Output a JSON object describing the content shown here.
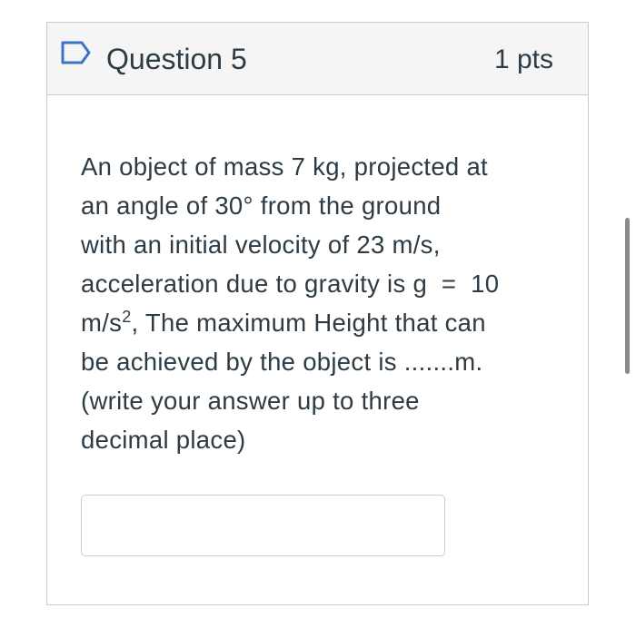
{
  "question": {
    "title": "Question 5",
    "points": "1 pts",
    "text_lines": [
      "An object of mass 7 kg, projected at",
      "an angle of 30° from the ground",
      "with an initial velocity of 23 m/s,",
      "acceleration due to gravity is g  =  10",
      "m/s",
      "2",
      ", The maximum Height that can",
      "be achieved by the object is .......m.",
      "(write your answer up to three",
      "decimal place)"
    ],
    "answer": {
      "value": "",
      "placeholder": ""
    }
  },
  "icons": {
    "flag": "bookmark-flag-icon"
  },
  "colors": {
    "flag_stroke": "#3b73c9",
    "header_bg": "#f5f5f5",
    "border": "#c7cdd1",
    "text": "#2d3b45"
  }
}
